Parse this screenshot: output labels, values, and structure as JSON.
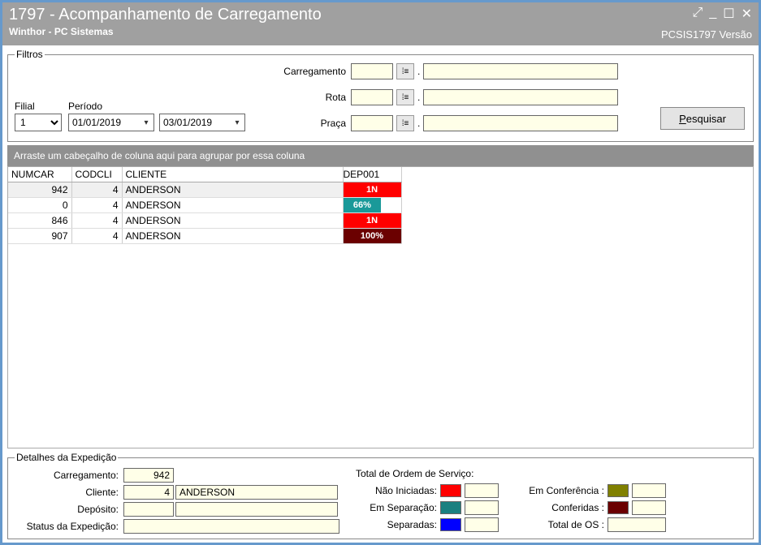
{
  "titlebar": {
    "title": "1797 - Acompanhamento de Carregamento",
    "subtitle": "Winthor - PC Sistemas",
    "version": "PCSIS1797  Versão"
  },
  "filtros": {
    "legend": "Filtros",
    "filial_label": "Filial",
    "filial_value": "1",
    "periodo_label": "Período",
    "date_from": "01/01/2019",
    "date_to": "03/01/2019",
    "carregamento_label": "Carregamento",
    "rota_label": "Rota",
    "praca_label": "Praça",
    "pesquisar_label": "Pesquisar"
  },
  "group_bar": "Arraste um cabeçalho de coluna aqui para agrupar por essa coluna",
  "grid": {
    "headers": {
      "numcar": "NUMCAR",
      "codcli": "CODCLI",
      "cliente": "CLIENTE",
      "dep": "DEP001"
    },
    "rows": [
      {
        "numcar": "942",
        "codcli": "4",
        "cliente": "ANDERSON",
        "dep_text": "1N",
        "dep_style": "red",
        "selected": true
      },
      {
        "numcar": "0",
        "codcli": "4",
        "cliente": "ANDERSON",
        "dep_text": "66%",
        "dep_style": "teal",
        "selected": false
      },
      {
        "numcar": "846",
        "codcli": "4",
        "cliente": "ANDERSON",
        "dep_text": "1N",
        "dep_style": "red",
        "selected": false
      },
      {
        "numcar": "907",
        "codcli": "4",
        "cliente": "ANDERSON",
        "dep_text": "100%",
        "dep_style": "dark",
        "selected": false
      }
    ]
  },
  "detalhes": {
    "legend": "Detalhes da Expedição",
    "carregamento_label": "Carregamento:",
    "carregamento_value": "942",
    "cliente_label": "Cliente:",
    "cliente_code": "4",
    "cliente_name": "ANDERSON",
    "deposito_label": "Depósito:",
    "deposito_code": "",
    "deposito_name": "",
    "status_label": "Status da Expedição:",
    "status_value": "",
    "total_os_title": "Total de Ordem de Serviço:",
    "nao_iniciadas": "Não Iniciadas:",
    "em_separacao": "Em Separação:",
    "separadas": "Separadas:",
    "em_conferencia": "Em Conferência :",
    "conferidas": "Conferidas :",
    "total_de_os": "Total de OS :"
  }
}
